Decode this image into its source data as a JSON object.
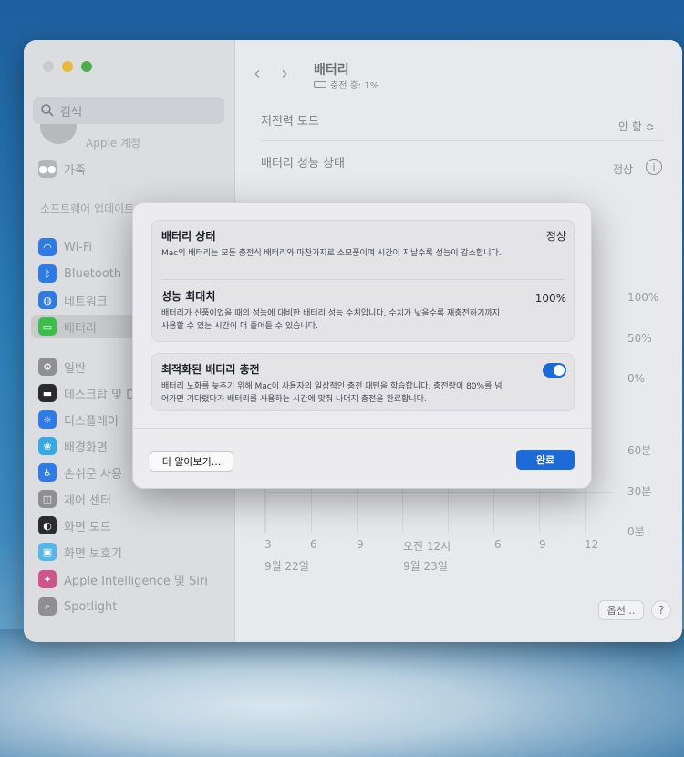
{
  "sidebar": {
    "search_placeholder": "검색",
    "account_sub": "Apple 계정",
    "family": "가족",
    "software_update": "소프트웨어 업데이트",
    "items": [
      {
        "label": "Wi-Fi",
        "color": "#2f7be6"
      },
      {
        "label": "Bluetooth",
        "color": "#2f7be6"
      },
      {
        "label": "네트워크",
        "color": "#2f7be6"
      },
      {
        "label": "배터리",
        "color": "#3cbf4a"
      },
      {
        "label": "일반",
        "color": "#8e8e93"
      },
      {
        "label": "데스크탑 및 Dock",
        "color": "#2b2b2d"
      },
      {
        "label": "디스플레이",
        "color": "#2f7be6"
      },
      {
        "label": "배경화면",
        "color": "#35a9e6"
      },
      {
        "label": "손쉬운 사용",
        "color": "#2f7be6"
      },
      {
        "label": "제어 센터",
        "color": "#8e8e93"
      },
      {
        "label": "화면 모드",
        "color": "#2b2b2d"
      },
      {
        "label": "화면 보호기",
        "color": "#55b6e8"
      },
      {
        "label": "Apple Intelligence 및 Siri",
        "color": "#d0548c"
      },
      {
        "label": "Spotlight",
        "color": "#8e8e93"
      }
    ]
  },
  "main": {
    "title": "배터리",
    "subtitle": "충전 중: 1%",
    "low_power_label": "저전력 모드",
    "low_power_value": "안 함 ≎",
    "health_label": "배터리 성능 상태",
    "health_value": "정상",
    "chart": {
      "y_right_top": [
        "100%",
        "50%",
        "0%"
      ],
      "y_right_bottom": [
        "60분",
        "30분",
        "0분"
      ],
      "x_ticks": [
        "3",
        "6",
        "9",
        "오전 12시",
        "6",
        "9",
        "12"
      ],
      "dates": [
        "9월 22일",
        "9월 23일"
      ]
    },
    "options_label": "옵션...",
    "help_label": "?"
  },
  "modal": {
    "battery_state_title": "배터리 상태",
    "battery_state_value": "정상",
    "battery_state_desc": "Mac의 배터리는 모든 충전식 배터리와 마찬가지로 소모품이며 시간이 지날수록 성능이 감소합니다.",
    "max_capacity_title": "성능 최대치",
    "max_capacity_value": "100%",
    "max_capacity_desc": "배터리가 신품이었을 때의 성능에 대비한 배터리 성능 수치입니다. 수치가 낮을수록 재충전하기까지 사용할 수 있는 시간이 더 줄어들 수 있습니다.",
    "optimized_title": "최적화된 배터리 충전",
    "optimized_desc": "배터리 노화를 늦추기 위해 Mac이 사용자의 일상적인 충전 패턴을 학습합니다. 충전량이 80%를 넘어가면 기다렸다가 배터리를 사용하는 시간에 맞춰 나머지 충전을 완료합니다.",
    "optimized_on": true,
    "learn_more": "더 알아보기...",
    "done": "완료"
  }
}
